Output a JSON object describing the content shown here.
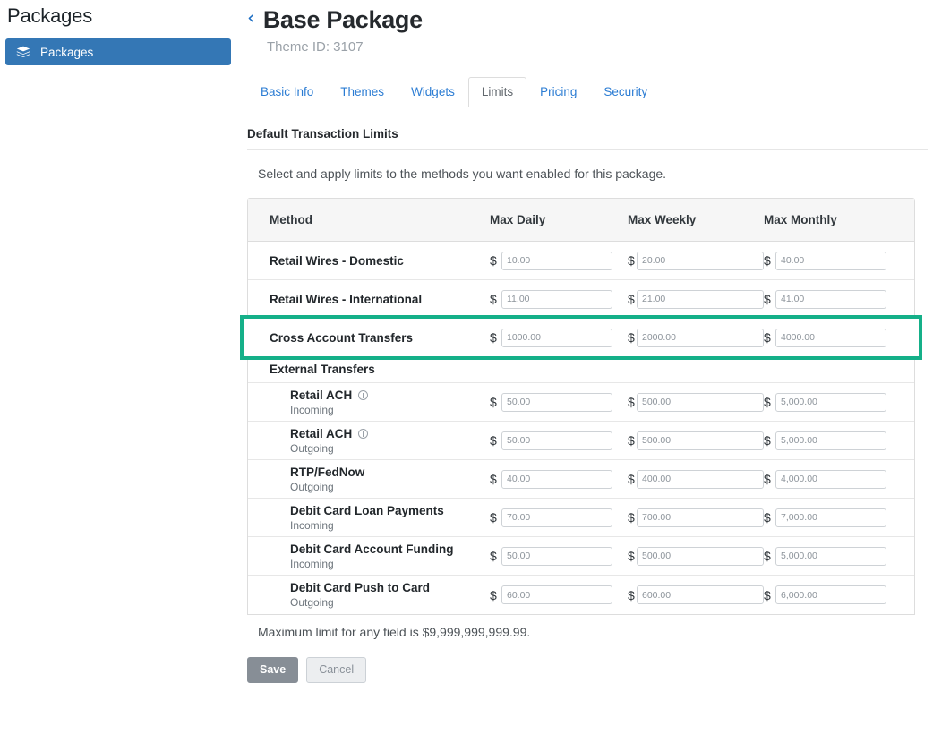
{
  "sidebar": {
    "title": "Packages",
    "items": [
      {
        "label": "Packages",
        "icon": "layers-icon",
        "active": true
      }
    ]
  },
  "header": {
    "back_icon": "chevron-left-icon",
    "back_glyph": "‹",
    "title": "Base Package",
    "theme_id_label": "Theme ID: 3107"
  },
  "tabs": [
    {
      "label": "Basic Info",
      "active": false
    },
    {
      "label": "Themes",
      "active": false
    },
    {
      "label": "Widgets",
      "active": false
    },
    {
      "label": "Limits",
      "active": true
    },
    {
      "label": "Pricing",
      "active": false
    },
    {
      "label": "Security",
      "active": false
    }
  ],
  "section": {
    "title": "Default Transaction Limits",
    "description": "Select and apply limits to the methods you want enabled for this package."
  },
  "table": {
    "columns": [
      "Method",
      "Max Daily",
      "Max Weekly",
      "Max Monthly"
    ],
    "currency_symbol": "$",
    "rows": [
      {
        "method": "Retail Wires - Domestic",
        "sub": "",
        "info": false,
        "indent": false,
        "highlight": false,
        "daily": "10.00",
        "weekly": "20.00",
        "monthly": "40.00"
      },
      {
        "method": "Retail Wires - International",
        "sub": "",
        "info": false,
        "indent": false,
        "highlight": false,
        "daily": "11.00",
        "weekly": "21.00",
        "monthly": "41.00"
      },
      {
        "method": "Cross Account Transfers",
        "sub": "",
        "info": false,
        "indent": false,
        "highlight": true,
        "daily": "1000.00",
        "weekly": "2000.00",
        "monthly": "4000.00"
      },
      {
        "group_label": "External Transfers"
      },
      {
        "method": "Retail ACH",
        "sub": "Incoming",
        "info": true,
        "indent": true,
        "highlight": false,
        "daily": "50.00",
        "weekly": "500.00",
        "monthly": "5,000.00"
      },
      {
        "method": "Retail ACH",
        "sub": "Outgoing",
        "info": true,
        "indent": true,
        "highlight": false,
        "daily": "50.00",
        "weekly": "500.00",
        "monthly": "5,000.00"
      },
      {
        "method": "RTP/FedNow",
        "sub": "Outgoing",
        "info": false,
        "indent": true,
        "highlight": false,
        "daily": "40.00",
        "weekly": "400.00",
        "monthly": "4,000.00"
      },
      {
        "method": "Debit Card Loan Payments",
        "sub": "Incoming",
        "info": false,
        "indent": true,
        "highlight": false,
        "daily": "70.00",
        "weekly": "700.00",
        "monthly": "7,000.00"
      },
      {
        "method": "Debit Card Account Funding",
        "sub": "Incoming",
        "info": false,
        "indent": true,
        "highlight": false,
        "daily": "50.00",
        "weekly": "500.00",
        "monthly": "5,000.00"
      },
      {
        "method": "Debit Card Push to Card",
        "sub": "Outgoing",
        "info": false,
        "indent": true,
        "highlight": false,
        "daily": "60.00",
        "weekly": "600.00",
        "monthly": "6,000.00"
      }
    ]
  },
  "footer": {
    "max_note": "Maximum limit for any field is $9,999,999,999.99.",
    "save_label": "Save",
    "cancel_label": "Cancel"
  },
  "colors": {
    "sidebar_active": "#3477b5",
    "highlight_outline": "#15b089",
    "link": "#2b7cd3",
    "save_button": "#878e96"
  }
}
